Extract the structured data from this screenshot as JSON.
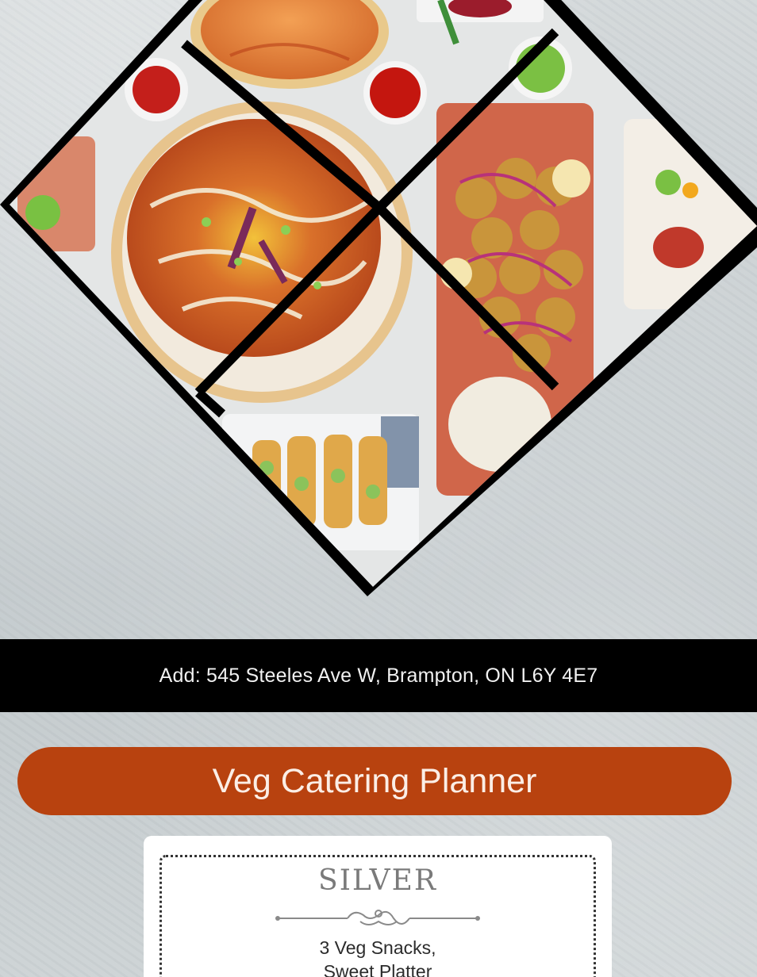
{
  "address": {
    "text": "Add: 545 Steeles Ave W, Brampton, ON L6Y 4E7"
  },
  "planner": {
    "title": "Veg Catering Planner"
  },
  "package": {
    "name": "SILVER",
    "line1": "3 Veg Snacks,",
    "line2": "Sweet Platter"
  },
  "colors": {
    "accent": "#b8420f",
    "bar": "#000000",
    "card": "#ffffff"
  }
}
